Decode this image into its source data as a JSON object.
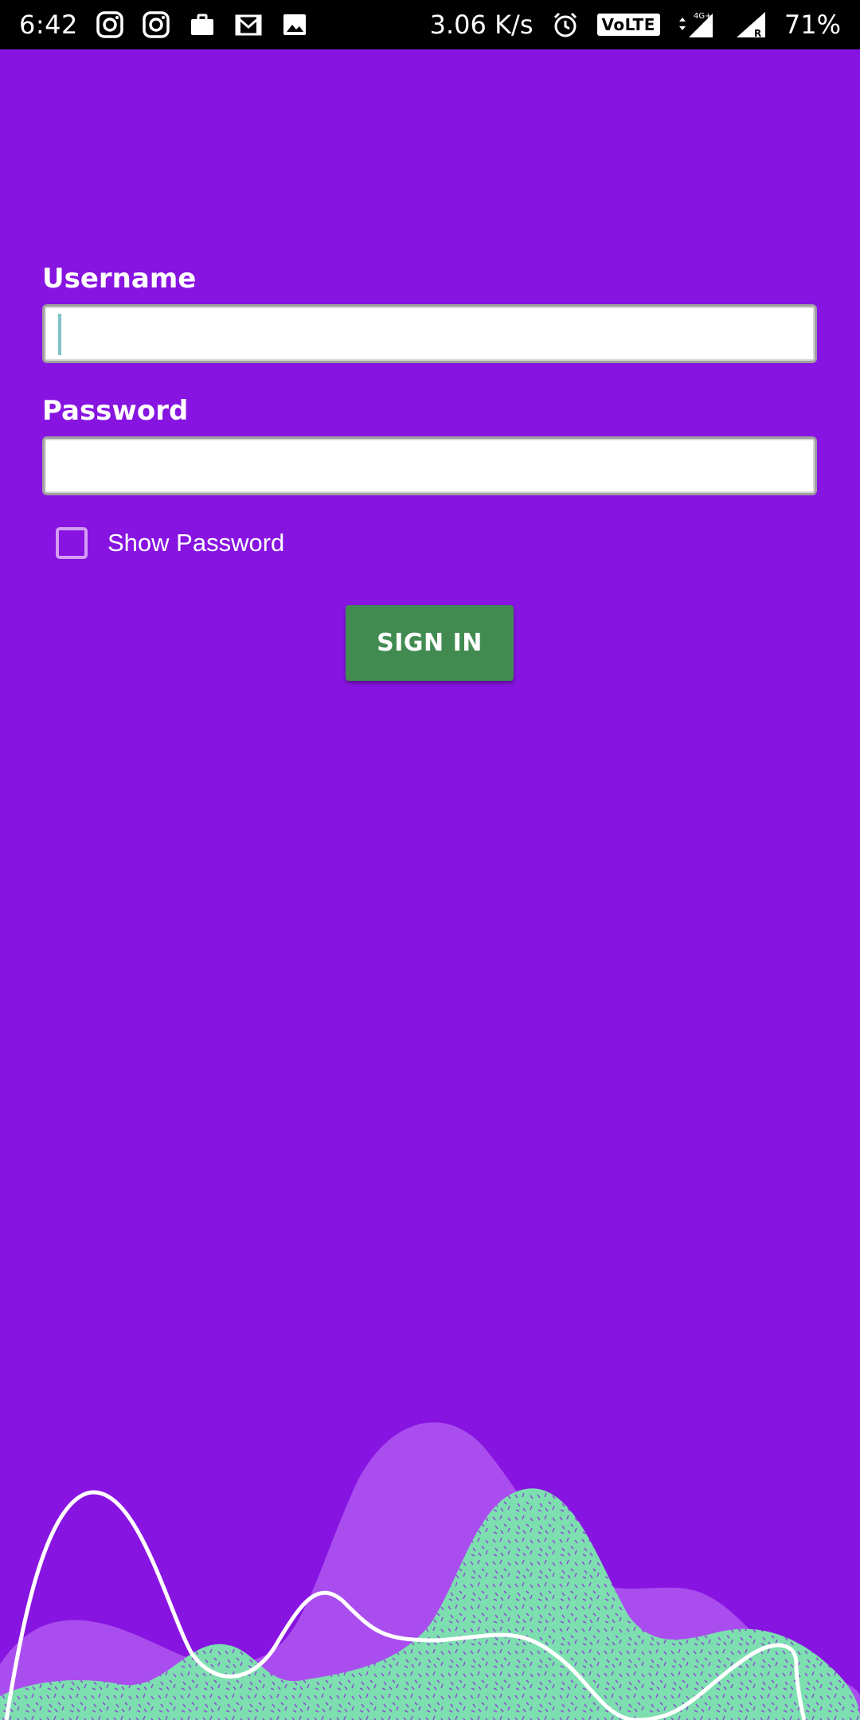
{
  "status_bar": {
    "time": "6:42",
    "net_speed": "3.06 K/s",
    "volte": "VoLTE",
    "network": "4G+",
    "roaming": "R",
    "battery": "71%",
    "left_icons": [
      "instagram-icon",
      "instagram-icon",
      "briefcase-icon",
      "gmail-icon",
      "image-icon"
    ],
    "right_icons": [
      "alarm-icon",
      "volte-icon",
      "data-arrows-icon",
      "signal-icon",
      "signal-roaming-icon"
    ]
  },
  "form": {
    "username_label": "Username",
    "username_value": "",
    "password_label": "Password",
    "password_value": "",
    "show_password_label": "Show Password",
    "show_password_checked": false,
    "signin_label": "SIGN IN"
  },
  "colors": {
    "background": "#8714e0",
    "button": "#418b51",
    "wave_light": "#aa4def",
    "wave_green": "#7ddfb0",
    "checkbox_border": "#d59ef5"
  }
}
